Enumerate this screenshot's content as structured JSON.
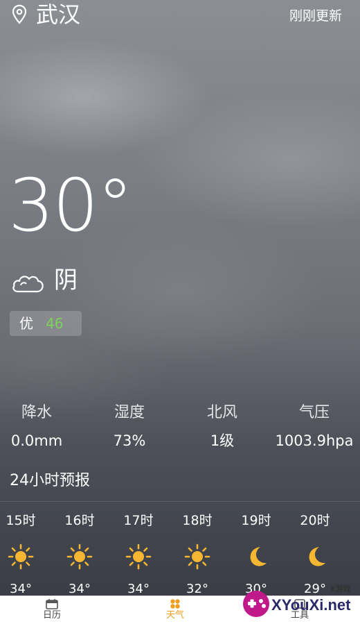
{
  "header": {
    "city": "武汉",
    "updated": "刚刚更新"
  },
  "current": {
    "temperature": "30°",
    "condition": "阴",
    "aqi_label": "优",
    "aqi_value": "46",
    "aqi_color": "#7ed35a"
  },
  "stats": [
    {
      "label": "降水",
      "value": "0.0mm"
    },
    {
      "label": "湿度",
      "value": "73%"
    },
    {
      "label": "北风",
      "value": "1级"
    },
    {
      "label": "气压",
      "value": "1003.9hpa"
    }
  ],
  "forecast": {
    "title": "24小时预报",
    "hours": [
      {
        "time": "15时",
        "icon": "sun-icon",
        "temp": "34°"
      },
      {
        "time": "16时",
        "icon": "sun-icon",
        "temp": "34°"
      },
      {
        "time": "17时",
        "icon": "sun-icon",
        "temp": "34°"
      },
      {
        "time": "18时",
        "icon": "sun-icon",
        "temp": "32°"
      },
      {
        "time": "19时",
        "icon": "moon-icon",
        "temp": "30°"
      },
      {
        "time": "20时",
        "icon": "moon-icon",
        "temp": "29°"
      }
    ]
  },
  "tabs": [
    {
      "label": "日历",
      "icon": "calendar-icon",
      "active": false
    },
    {
      "label": "天气",
      "icon": "weather-icon",
      "active": true
    },
    {
      "label": "工具",
      "icon": "tools-icon",
      "active": false
    }
  ],
  "colors": {
    "accent": "#f0a020",
    "icon_yellow": "#f5b731",
    "aqi_green": "#7ed35a"
  },
  "watermark": {
    "text": "XYouXi.net",
    "small": "X游戏"
  }
}
